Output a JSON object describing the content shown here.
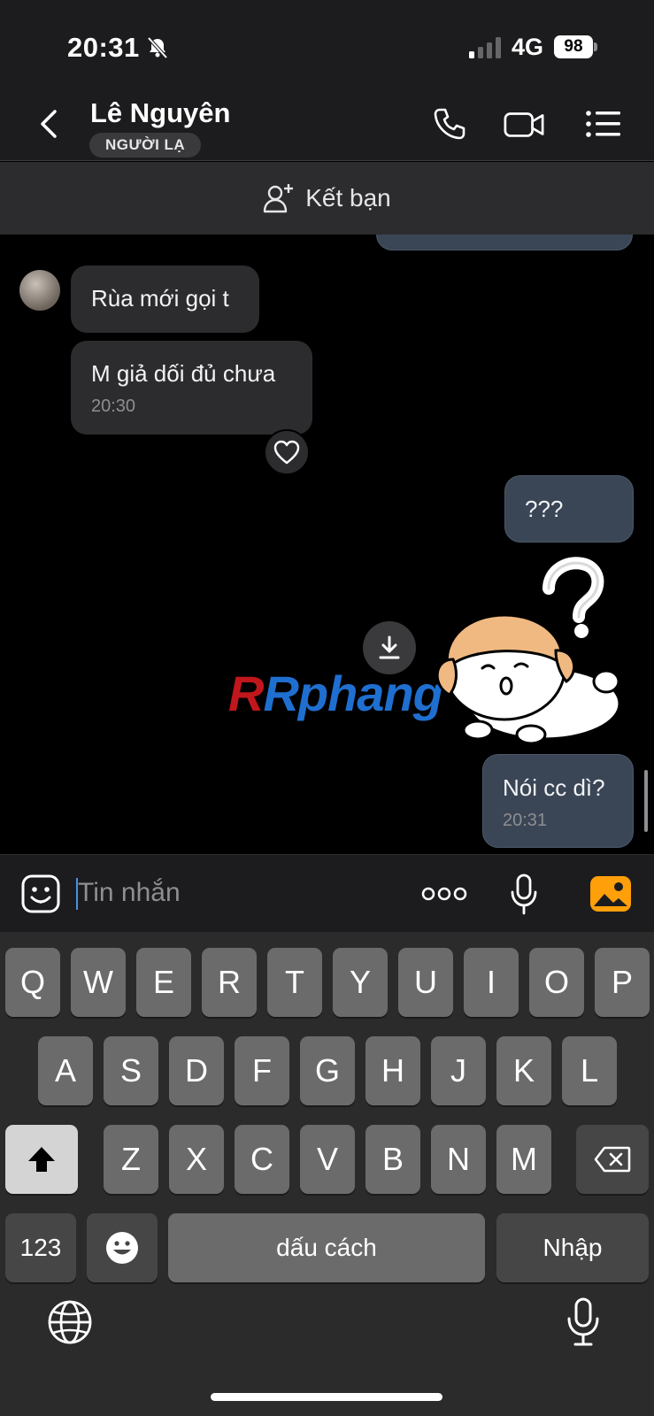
{
  "status_bar": {
    "time": "20:31",
    "network": "4G",
    "battery": "98"
  },
  "header": {
    "name": "Lê Nguyên",
    "badge": "NGƯỜI LẠ"
  },
  "add_friend": {
    "label": "Kết bạn"
  },
  "messages": {
    "incoming_1": {
      "text": "Rùa mới gọi t"
    },
    "incoming_2": {
      "text": "M giả dối đủ chưa",
      "time": "20:30"
    },
    "outgoing_1": {
      "text": "???"
    },
    "outgoing_2": {
      "text": "Nói cc dì?",
      "time": "20:31"
    }
  },
  "watermark": {
    "text": "Rphang"
  },
  "input": {
    "placeholder": "Tin nhắn"
  },
  "keyboard": {
    "row1": [
      "Q",
      "W",
      "E",
      "R",
      "T",
      "Y",
      "U",
      "I",
      "O",
      "P"
    ],
    "row2": [
      "A",
      "S",
      "D",
      "F",
      "G",
      "H",
      "J",
      "K",
      "L"
    ],
    "row3": [
      "Z",
      "X",
      "C",
      "V",
      "B",
      "N",
      "M"
    ],
    "numbers": "123",
    "space": "dấu cách",
    "return": "Nhập"
  },
  "colors": {
    "accent": "#4a90e2",
    "gallery_icon": "#ff9f0a",
    "outgoing_bubble": "#3a4655"
  }
}
